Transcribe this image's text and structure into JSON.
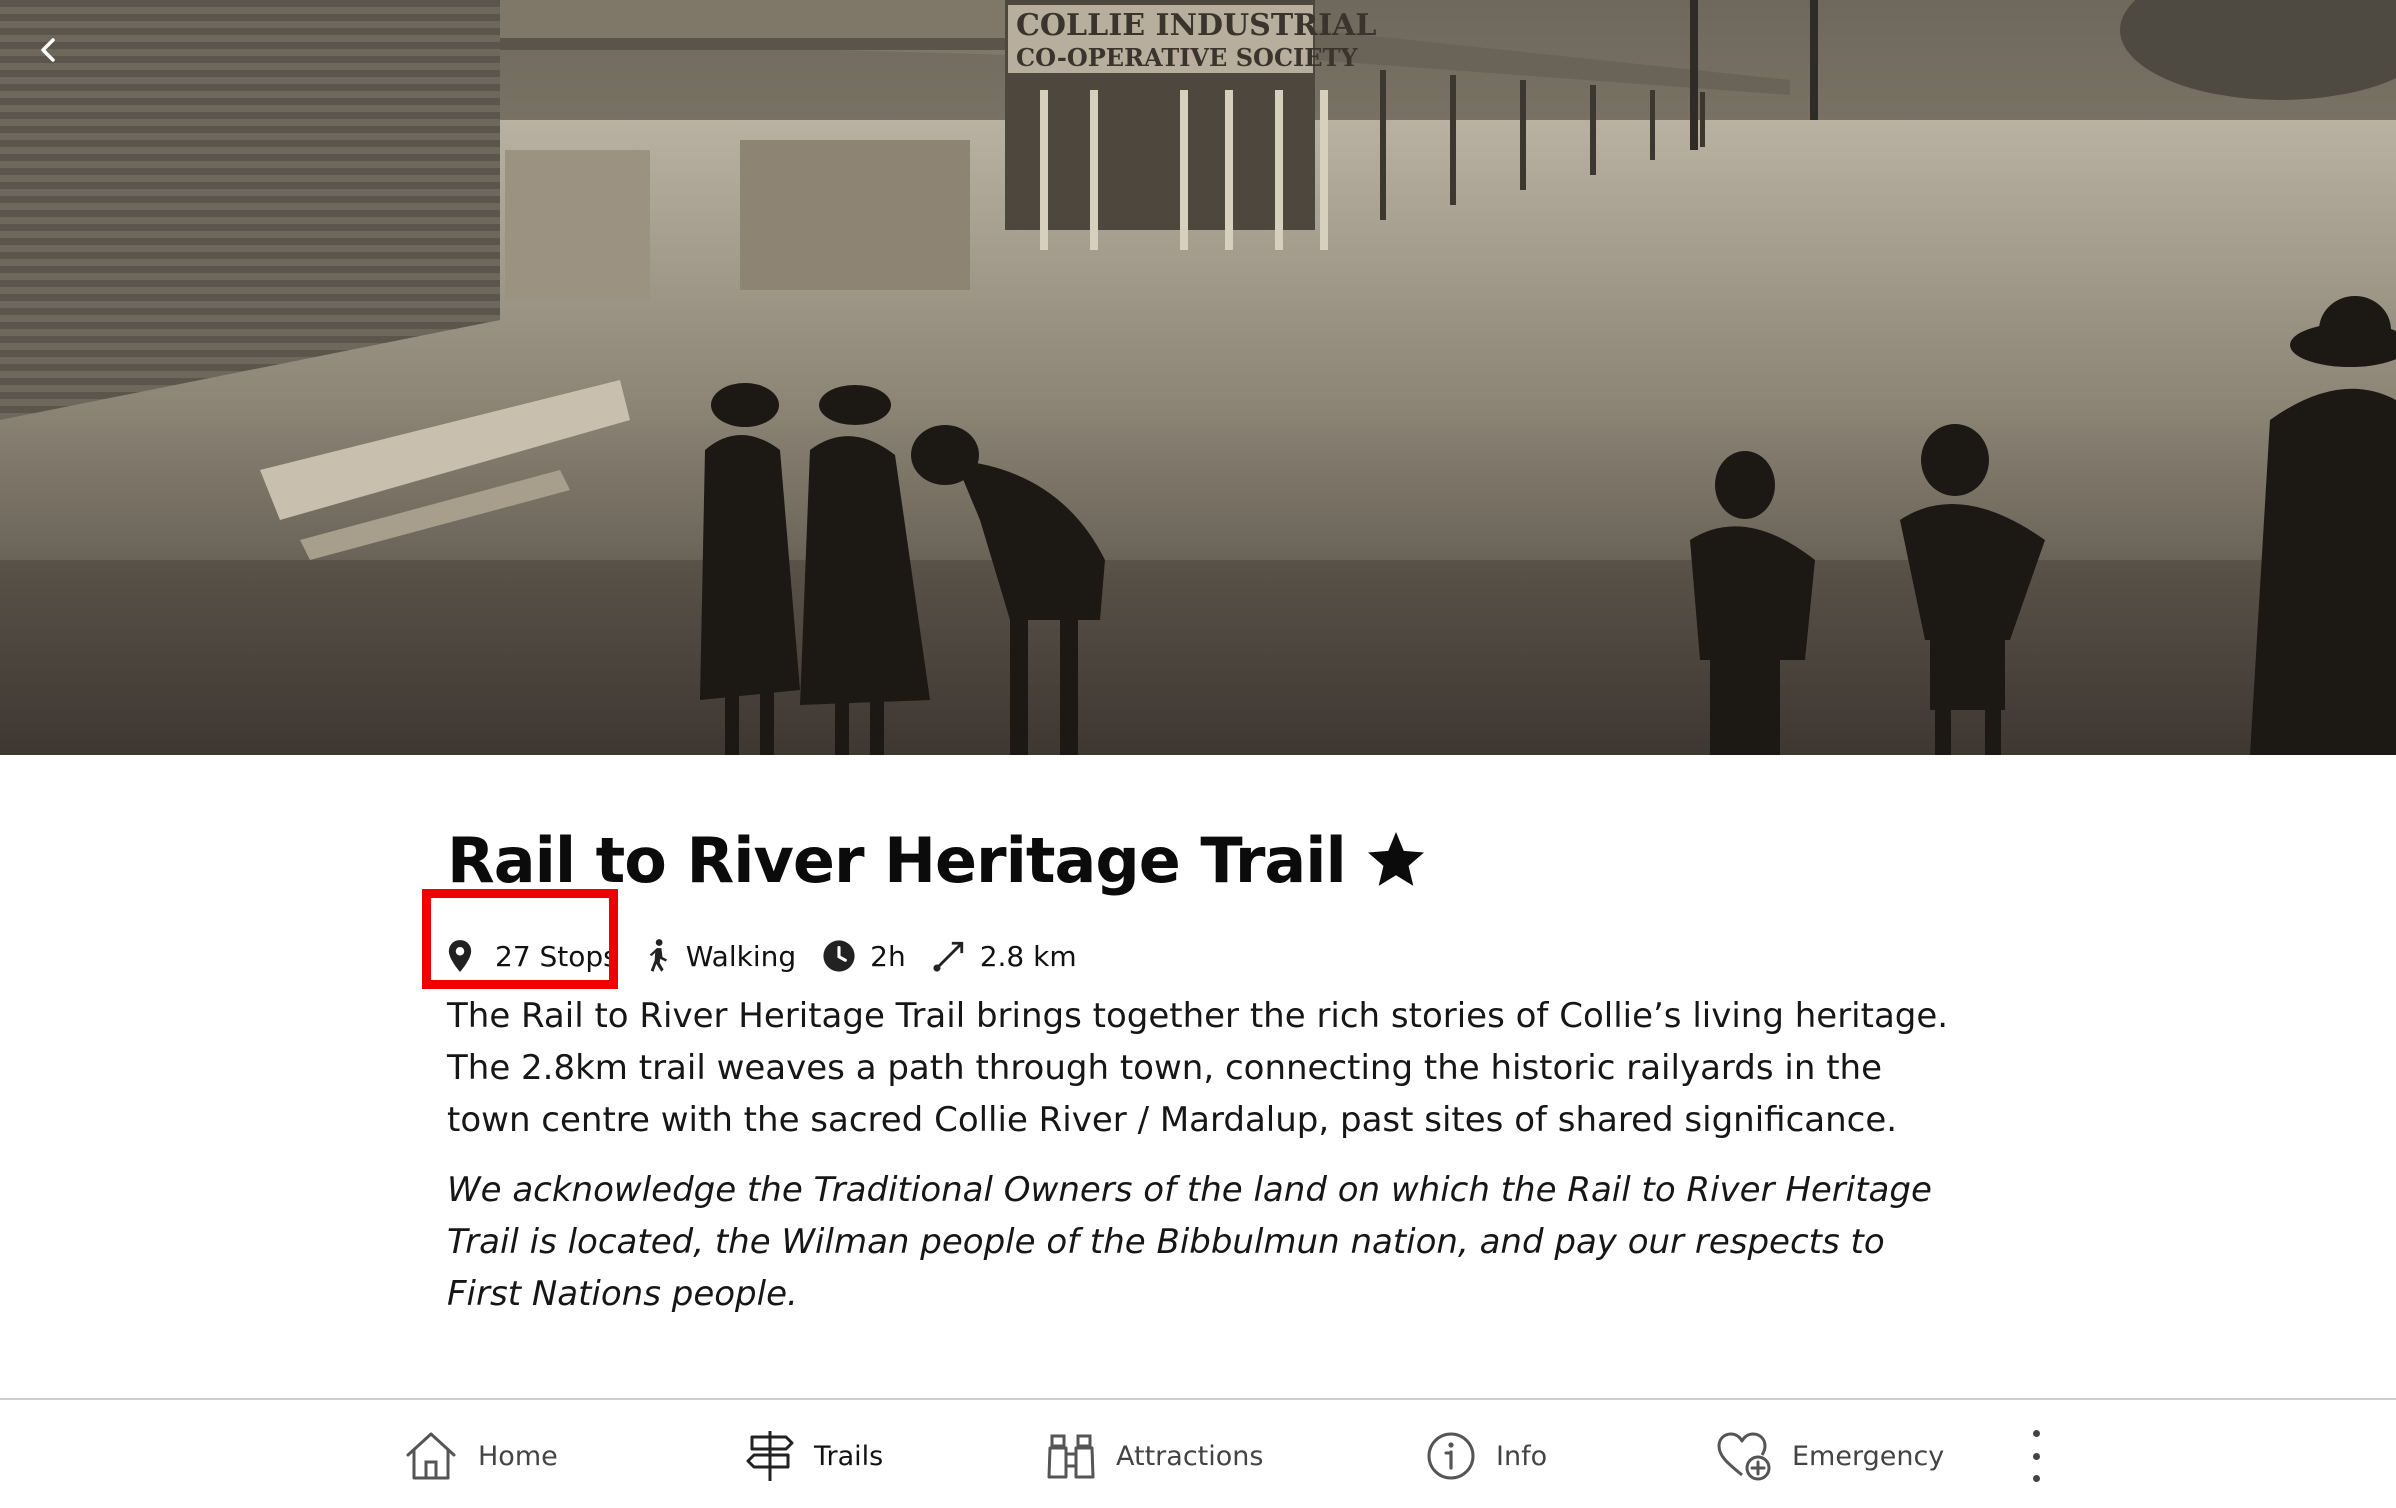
{
  "hero": {
    "photo_sign_line1": "COLLIE INDUSTRIAL",
    "photo_sign_line2": "CO-OPERATIVE SOCIETY"
  },
  "trail": {
    "title": "Rail to River Heritage Trail",
    "is_favorite": true,
    "stops": "27 Stops",
    "mode": "Walking",
    "duration": "2h",
    "distance": "2.8 km",
    "description": "The Rail to River Heritage Trail brings together the rich stories of Collie’s living heritage. The 2.8km trail weaves a path through town, connecting the historic railyards in the town centre with the sacred Collie River / Mardalup, past sites of shared significance.",
    "acknowledgement": "We acknowledge the Traditional Owners of the land on which the Rail to River Heritage Trail is located, the Wilman people of the Bibbulmun nation, and pay our respects to First Nations people."
  },
  "highlight": {
    "color": "#f00000",
    "target": "stops"
  },
  "nav": {
    "items": [
      {
        "label": "Home",
        "icon": "home-icon"
      },
      {
        "label": "Trails",
        "icon": "signpost-icon",
        "active": true
      },
      {
        "label": "Attractions",
        "icon": "binoculars-icon"
      },
      {
        "label": "Info",
        "icon": "info-icon"
      },
      {
        "label": "Emergency",
        "icon": "heart-plus-icon"
      }
    ],
    "more_icon": "more-vertical-icon"
  }
}
